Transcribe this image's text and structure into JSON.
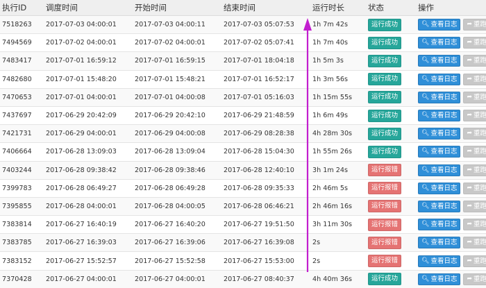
{
  "header": {
    "execution_id": "执行ID",
    "scheduled_time": "调度时间",
    "start_time": "开始时间",
    "end_time": "结束时间",
    "duration": "运行时长",
    "status": "状态",
    "actions": "操作"
  },
  "labels": {
    "view_log": "查看日志",
    "rerun": "重跑"
  },
  "colors": {
    "success": "#26a69a",
    "error": "#e57373",
    "log_button": "#2f8fd8",
    "rerun_button": "#c8c8c8",
    "annotation_arrow": "#c21ecf"
  },
  "rows": [
    {
      "id": "7518263",
      "scheduled": "2017-07-03 04:00:01",
      "start": "2017-07-03 04:00:11",
      "end": "2017-07-03 05:07:53",
      "duration": "1h 7m 42s",
      "status": "运行成功",
      "state": "ok"
    },
    {
      "id": "7494569",
      "scheduled": "2017-07-02 04:00:01",
      "start": "2017-07-02 04:00:01",
      "end": "2017-07-02 05:07:41",
      "duration": "1h 7m 40s",
      "status": "运行成功",
      "state": "ok"
    },
    {
      "id": "7483417",
      "scheduled": "2017-07-01 16:59:12",
      "start": "2017-07-01 16:59:15",
      "end": "2017-07-01 18:04:18",
      "duration": "1h 5m 3s",
      "status": "运行成功",
      "state": "ok"
    },
    {
      "id": "7482680",
      "scheduled": "2017-07-01 15:48:20",
      "start": "2017-07-01 15:48:21",
      "end": "2017-07-01 16:52:17",
      "duration": "1h 3m 56s",
      "status": "运行成功",
      "state": "ok"
    },
    {
      "id": "7470653",
      "scheduled": "2017-07-01 04:00:01",
      "start": "2017-07-01 04:00:08",
      "end": "2017-07-01 05:16:03",
      "duration": "1h 15m 55s",
      "status": "运行成功",
      "state": "ok"
    },
    {
      "id": "7437697",
      "scheduled": "2017-06-29 20:42:09",
      "start": "2017-06-29 20:42:10",
      "end": "2017-06-29 21:48:59",
      "duration": "1h 6m 49s",
      "status": "运行成功",
      "state": "ok"
    },
    {
      "id": "7421731",
      "scheduled": "2017-06-29 04:00:01",
      "start": "2017-06-29 04:00:08",
      "end": "2017-06-29 08:28:38",
      "duration": "4h 28m 30s",
      "status": "运行成功",
      "state": "ok"
    },
    {
      "id": "7406664",
      "scheduled": "2017-06-28 13:09:03",
      "start": "2017-06-28 13:09:04",
      "end": "2017-06-28 15:04:30",
      "duration": "1h 55m 26s",
      "status": "运行成功",
      "state": "ok"
    },
    {
      "id": "7403244",
      "scheduled": "2017-06-28 09:38:42",
      "start": "2017-06-28 09:38:46",
      "end": "2017-06-28 12:40:10",
      "duration": "3h 1m 24s",
      "status": "运行报错",
      "state": "err"
    },
    {
      "id": "7399783",
      "scheduled": "2017-06-28 06:49:27",
      "start": "2017-06-28 06:49:28",
      "end": "2017-06-28 09:35:33",
      "duration": "2h 46m 5s",
      "status": "运行报错",
      "state": "err"
    },
    {
      "id": "7395855",
      "scheduled": "2017-06-28 04:00:01",
      "start": "2017-06-28 04:00:05",
      "end": "2017-06-28 06:46:21",
      "duration": "2h 46m 16s",
      "status": "运行报错",
      "state": "err"
    },
    {
      "id": "7383814",
      "scheduled": "2017-06-27 16:40:19",
      "start": "2017-06-27 16:40:20",
      "end": "2017-06-27 19:51:50",
      "duration": "3h 11m 30s",
      "status": "运行报错",
      "state": "err"
    },
    {
      "id": "7383785",
      "scheduled": "2017-06-27 16:39:03",
      "start": "2017-06-27 16:39:06",
      "end": "2017-06-27 16:39:08",
      "duration": "2s",
      "status": "运行报错",
      "state": "err"
    },
    {
      "id": "7383152",
      "scheduled": "2017-06-27 15:52:57",
      "start": "2017-06-27 15:52:58",
      "end": "2017-06-27 15:53:00",
      "duration": "2s",
      "status": "运行报错",
      "state": "err"
    },
    {
      "id": "7370428",
      "scheduled": "2017-06-27 04:00:01",
      "start": "2017-06-27 04:00:01",
      "end": "2017-06-27 08:40:37",
      "duration": "4h 40m 36s",
      "status": "运行成功",
      "state": "ok"
    }
  ]
}
